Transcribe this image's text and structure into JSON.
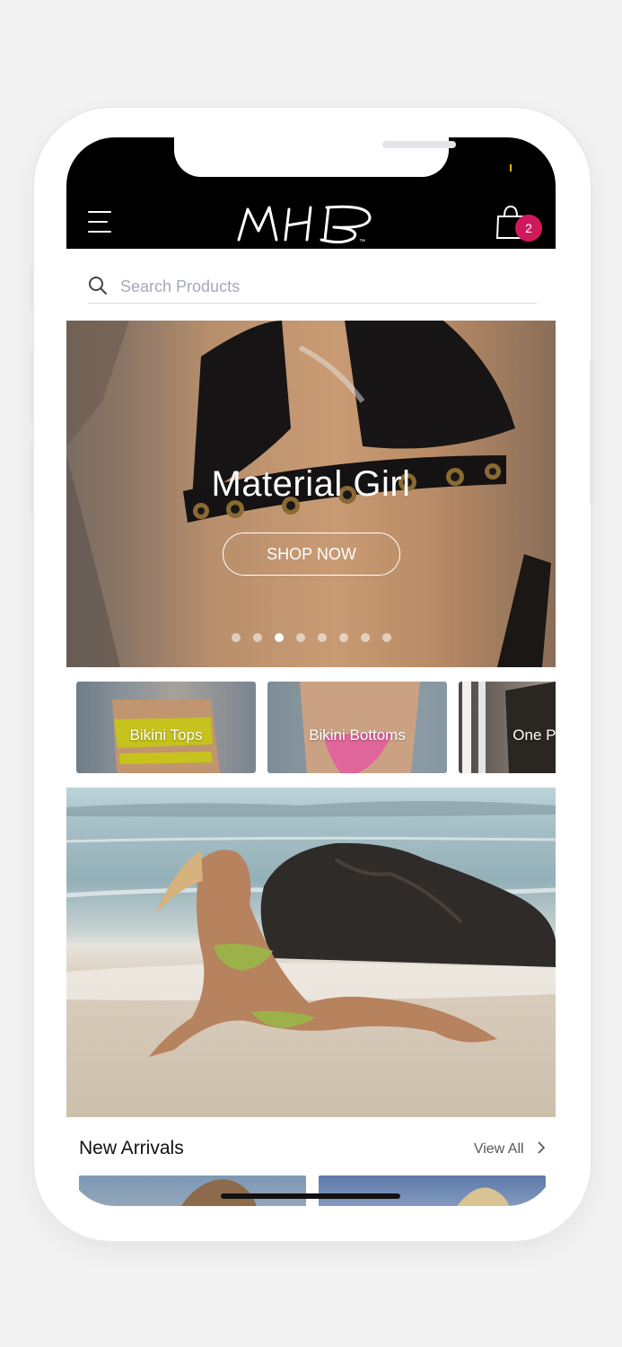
{
  "colors": {
    "header_bg": "#000000",
    "badge": "#d0195c",
    "page_bg": "#f2f2f3"
  },
  "header": {
    "menu_icon": "hamburger-menu-icon",
    "logo_text": "MHB",
    "logo_mark": "™",
    "cart_icon": "shopping-bag-icon",
    "cart_count": "2"
  },
  "search": {
    "placeholder": "Search Products",
    "icon": "search-icon"
  },
  "hero": {
    "title": "Material Girl",
    "button_label": "SHOP NOW",
    "slide_count": 8,
    "active_slide": 3
  },
  "categories": [
    {
      "label": "Bikini Tops"
    },
    {
      "label": "Bikini Bottoms"
    },
    {
      "label": "One Piece"
    }
  ],
  "new_arrivals": {
    "title": "New Arrivals",
    "view_all_label": "View All",
    "view_all_icon": "chevron-right-icon"
  }
}
